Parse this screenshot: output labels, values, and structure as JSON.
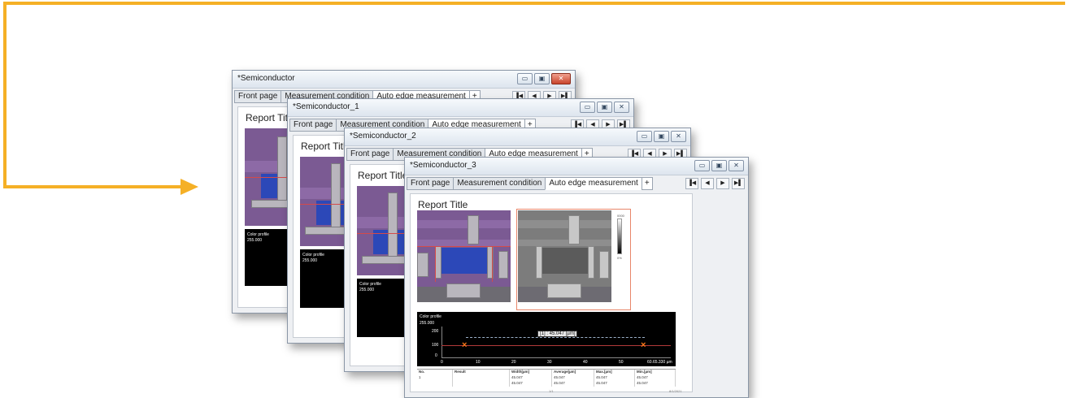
{
  "arrow": {
    "color": "#F5B026"
  },
  "tabs": {
    "front": "Front page",
    "measurement": "Measurement condition",
    "auto": "Auto edge measurement",
    "plus": "+"
  },
  "nav_icons": [
    "first-icon",
    "prev-icon",
    "next-icon",
    "last-icon"
  ],
  "nav_glyphs": {
    "first": "▐◀",
    "prev": "◀",
    "next": "▶",
    "last": "▶▌"
  },
  "window_glyphs": {
    "minimize": "▭",
    "maximize": "▣",
    "close": "✕"
  },
  "windows": [
    {
      "title": "*Semiconductor"
    },
    {
      "title": "*Semiconductor_1"
    },
    {
      "title": "*Semiconductor_2"
    },
    {
      "title": "*Semiconductor_3"
    }
  ],
  "report": {
    "title": "Report Title",
    "profile_label": "Color profile",
    "profile_max": "255.000",
    "y_ticks": [
      "200",
      "100",
      "0"
    ],
    "x_ticks": [
      "0",
      "10",
      "20",
      "30",
      "40",
      "50",
      "60.65.330 µm"
    ],
    "measurement": "[1] : 45.047 [µm]",
    "colorbar_top": "0000",
    "colorbar_bottom": "0%",
    "table_headers": [
      "No.",
      "Result",
      "Width[µm]",
      "Average[µm]",
      "Max.[µm]",
      "Min.[µm]"
    ],
    "table_row": [
      "1",
      "",
      "45.047",
      "45.047",
      "45.047",
      "45.047"
    ],
    "table_row_2": [
      "",
      "",
      "45.047",
      "45.047",
      "45.047",
      "45.047"
    ],
    "page": "1/1",
    "date": "8/1/2021"
  }
}
